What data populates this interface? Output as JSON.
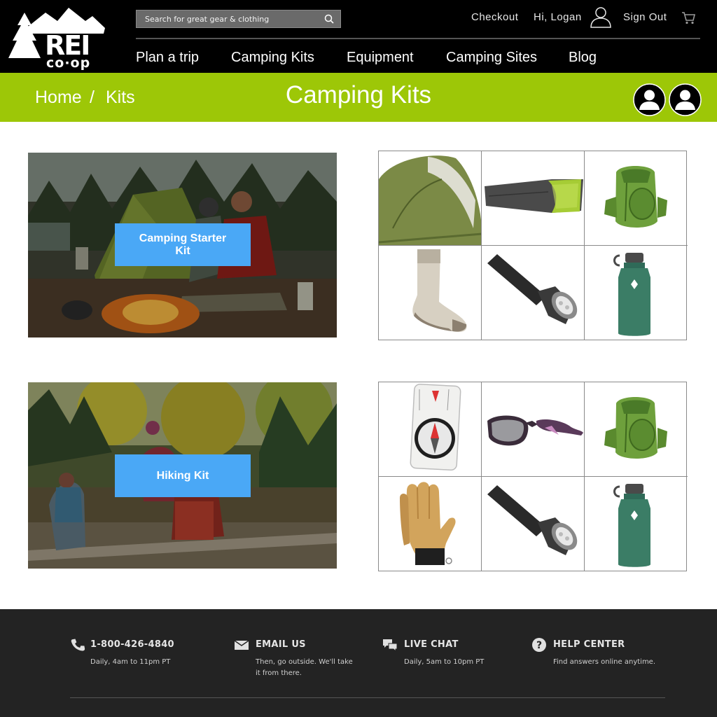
{
  "header": {
    "search_placeholder": "Search for great gear & clothing",
    "checkout_label": "Checkout",
    "greeting": "Hi, Logan",
    "sign_out_label": "Sign Out",
    "nav": [
      "Plan a trip",
      "Camping Kits",
      "Equipment",
      "Camping Sites",
      "Blog"
    ]
  },
  "banner": {
    "breadcrumb": [
      "Home",
      "Kits"
    ],
    "breadcrumb_separator": "/",
    "title": "Camping Kits"
  },
  "kits": [
    {
      "label": "Camping Starter Kit",
      "items": [
        "tent",
        "sleeping-bag",
        "backpack",
        "sock",
        "flashlight",
        "water-bottle"
      ]
    },
    {
      "label": "Hiking Kit",
      "items": [
        "compass",
        "sunglasses",
        "backpack",
        "gloves",
        "flashlight",
        "water-bottle"
      ]
    }
  ],
  "footer": {
    "phone": {
      "title": "1-800-426-4840",
      "text": "Daily, 4am to 11pm PT"
    },
    "email": {
      "title": "EMAIL US",
      "text": "Then, go outside. We'll take it from there."
    },
    "chat": {
      "title": "LIVE CHAT",
      "text": "Daily, 5am to 10pm PT"
    },
    "help": {
      "title": "HELP CENTER",
      "text": "Find answers online anytime."
    }
  },
  "colors": {
    "header_bg": "#000000",
    "banner_green": "#9dc707",
    "button_blue": "#4aa8f6",
    "footer_bg": "#232323"
  }
}
